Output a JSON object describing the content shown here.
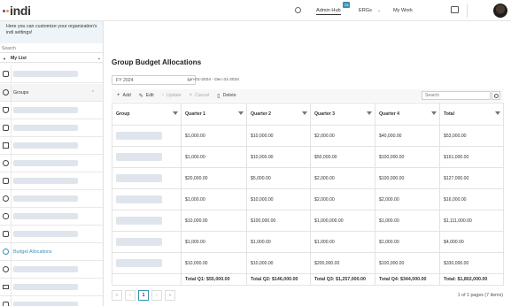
{
  "topbar": {
    "logo_text": "indi",
    "nav": {
      "admin_hub": "Admin Hub",
      "admin_badge": "25",
      "ergs": "ERGs",
      "my_work": "My Work"
    }
  },
  "sidebar": {
    "help_text": "Here you can customize your organization's indi settings!",
    "search_placeholder": "Search",
    "my_list": "My List",
    "groups_label": "Groups",
    "budget_label": "Budget Allocations"
  },
  "page": {
    "title": "Group Budget Allocations",
    "fiscal_year": "FY 2024",
    "date_range": "Jan-01-2024 - Dec-31-2024"
  },
  "toolbar": {
    "add": "Add",
    "edit": "Edit",
    "update": "Update",
    "cancel": "Cancel",
    "delete": "Delete",
    "search_placeholder": "Search"
  },
  "table": {
    "headers": [
      "Group",
      "Quarter 1",
      "Quarter 2",
      "Quarter 3",
      "Quarter 4",
      "Total"
    ],
    "rows": [
      [
        "",
        "$1,000.00",
        "$10,000.00",
        "$2,000.00",
        "$40,000.00",
        "$53,000.00"
      ],
      [
        "",
        "$1,000.00",
        "$10,000.00",
        "$50,000.00",
        "$100,000.00",
        "$161,000.00"
      ],
      [
        "",
        "$20,000.00",
        "$5,000.00",
        "$2,000.00",
        "$100,000.00",
        "$127,000.00"
      ],
      [
        "",
        "$1,000.00",
        "$10,000.00",
        "$2,000.00",
        "$2,000.00",
        "$16,000.00"
      ],
      [
        "",
        "$10,000.00",
        "$100,000.00",
        "$1,000,000.00",
        "$1,000.00",
        "$1,111,000.00"
      ],
      [
        "",
        "$1,000.00",
        "$1,000.00",
        "$1,000.00",
        "$1,000.00",
        "$4,000.00"
      ],
      [
        "",
        "$10,000.00",
        "$10,000.00",
        "$200,000.00",
        "$100,000.00",
        "$330,000.00"
      ]
    ],
    "totals": [
      "",
      "Total Q1: $55,000.00",
      "Total Q2: $146,000.00",
      "Total Q3: $1,257,000.00",
      "Total Q4: $344,000.00",
      "Total: $1,802,000.00"
    ]
  },
  "pager": {
    "first": "«",
    "prev": "‹",
    "current": "1",
    "next": "›",
    "last": "»",
    "info": "1 of 1 pages (7 items)"
  },
  "colors": {
    "accent": "#3c8fb5",
    "placeholder": "#dfe5ec",
    "help_bg": "#eef4f7"
  }
}
